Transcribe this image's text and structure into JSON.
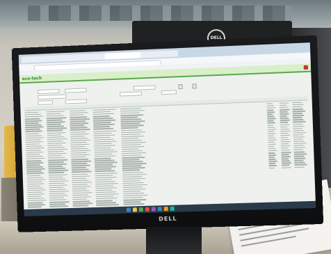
{
  "back_monitor": {
    "brand": "DELL"
  },
  "monitor": {
    "brand": "DELL"
  },
  "browser": {
    "tabs": [
      "",
      "",
      "",
      "",
      ""
    ],
    "address": ""
  },
  "app": {
    "logo": "eco-tech",
    "page_title": "",
    "row_count": 46
  },
  "colors": {
    "accent": "#5aa84f",
    "header_bg": "#d9efc9",
    "chrome": "#c8d7e6"
  }
}
